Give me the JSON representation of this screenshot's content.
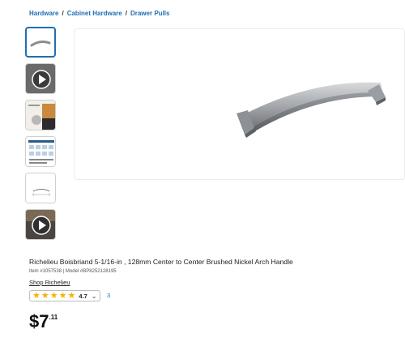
{
  "breadcrumb": {
    "items": [
      "Hardware",
      "Cabinet Hardware",
      "Drawer Pulls"
    ],
    "separator": "/"
  },
  "product": {
    "title": "Richelieu Boisbriand 5-1/16-in , 128mm Center to Center Brushed Nickel Arch Handle",
    "item_line": "Item #1057538 | Model #BP8252128195",
    "brand_link": "Shop Richelieu",
    "rating_value": "4.7",
    "rating_count": "3",
    "price_main": "$7",
    "price_cents": ".11"
  },
  "colors": {
    "link": "#1f6fb2",
    "star": "#f0b400",
    "active_border": "#1f6fb2"
  },
  "thumbnails": [
    "handle-image",
    "video-play-icon",
    "product-closeup-image",
    "spec-sheet-image",
    "dimension-drawing-image",
    "video-play-icon"
  ]
}
